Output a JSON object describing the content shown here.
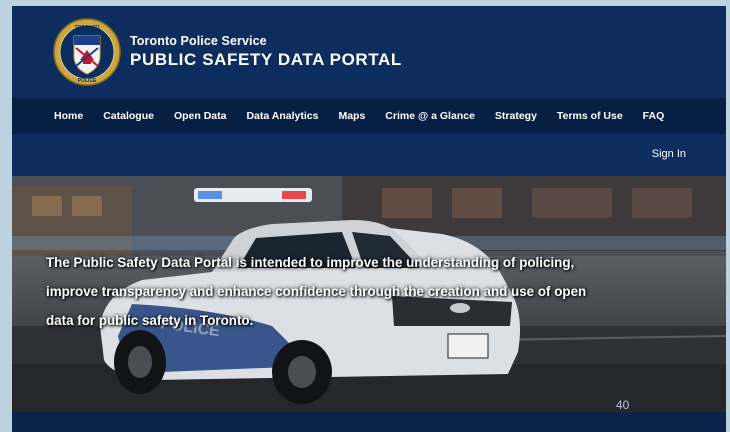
{
  "header": {
    "org_name": "Toronto Police Service",
    "portal_title": "PUBLIC SAFETY DATA PORTAL",
    "crest_text_top": "TORONTO",
    "crest_text_bottom": "POLICE"
  },
  "nav": {
    "items": [
      {
        "label": "Home"
      },
      {
        "label": "Catalogue"
      },
      {
        "label": "Open Data"
      },
      {
        "label": "Data Analytics"
      },
      {
        "label": "Maps"
      },
      {
        "label": "Crime @ a Glance"
      },
      {
        "label": "Strategy"
      },
      {
        "label": "Terms of Use"
      },
      {
        "label": "FAQ"
      }
    ]
  },
  "account": {
    "sign_in_label": "Sign In"
  },
  "hero": {
    "lines": [
      "The Public Safety Data Portal is intended to improve the understanding of policing,",
      "improve transparency and enhance confidence through the creation and use of open",
      "data for public safety in Toronto."
    ],
    "car_door_text": "POLICE"
  },
  "slide": {
    "page_number": "40"
  },
  "colors": {
    "header_bg": "#0d2d5e",
    "nav_bg": "#081f44",
    "text": "#ffffff"
  }
}
